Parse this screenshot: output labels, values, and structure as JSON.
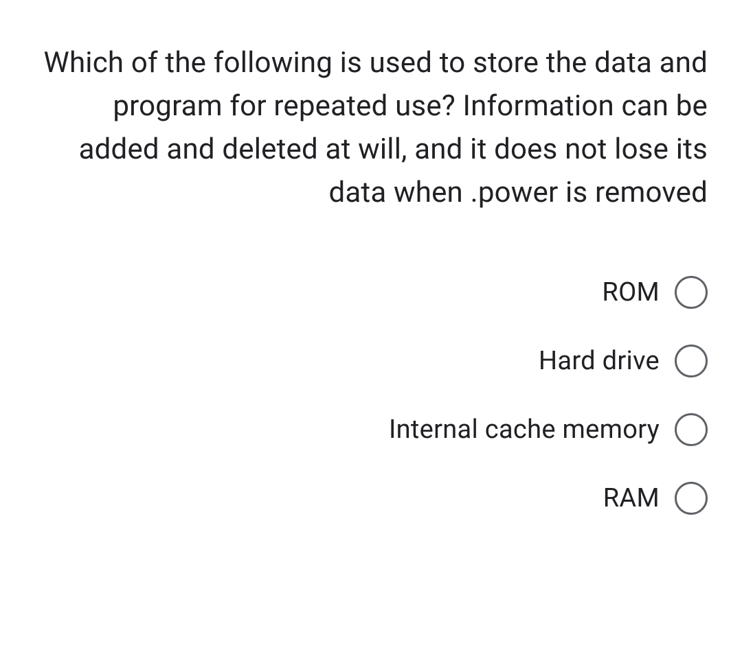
{
  "question": {
    "text": "Which of the following is used to store the data and program for repeated use? Information can be added and deleted at will, and it does not lose its data when .power is removed"
  },
  "options": [
    {
      "label": "ROM"
    },
    {
      "label": "Hard drive"
    },
    {
      "label": "Internal cache memory"
    },
    {
      "label": "RAM"
    }
  ]
}
